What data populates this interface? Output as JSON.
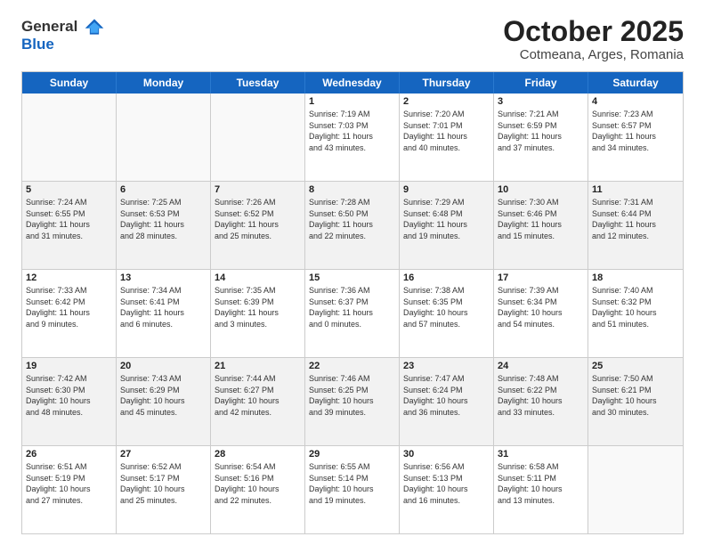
{
  "logo": {
    "general": "General",
    "blue": "Blue"
  },
  "title": "October 2025",
  "subtitle": "Cotmeana, Arges, Romania",
  "header_days": [
    "Sunday",
    "Monday",
    "Tuesday",
    "Wednesday",
    "Thursday",
    "Friday",
    "Saturday"
  ],
  "weeks": [
    [
      {
        "day": "",
        "info": ""
      },
      {
        "day": "",
        "info": ""
      },
      {
        "day": "",
        "info": ""
      },
      {
        "day": "1",
        "info": "Sunrise: 7:19 AM\nSunset: 7:03 PM\nDaylight: 11 hours\nand 43 minutes."
      },
      {
        "day": "2",
        "info": "Sunrise: 7:20 AM\nSunset: 7:01 PM\nDaylight: 11 hours\nand 40 minutes."
      },
      {
        "day": "3",
        "info": "Sunrise: 7:21 AM\nSunset: 6:59 PM\nDaylight: 11 hours\nand 37 minutes."
      },
      {
        "day": "4",
        "info": "Sunrise: 7:23 AM\nSunset: 6:57 PM\nDaylight: 11 hours\nand 34 minutes."
      }
    ],
    [
      {
        "day": "5",
        "info": "Sunrise: 7:24 AM\nSunset: 6:55 PM\nDaylight: 11 hours\nand 31 minutes."
      },
      {
        "day": "6",
        "info": "Sunrise: 7:25 AM\nSunset: 6:53 PM\nDaylight: 11 hours\nand 28 minutes."
      },
      {
        "day": "7",
        "info": "Sunrise: 7:26 AM\nSunset: 6:52 PM\nDaylight: 11 hours\nand 25 minutes."
      },
      {
        "day": "8",
        "info": "Sunrise: 7:28 AM\nSunset: 6:50 PM\nDaylight: 11 hours\nand 22 minutes."
      },
      {
        "day": "9",
        "info": "Sunrise: 7:29 AM\nSunset: 6:48 PM\nDaylight: 11 hours\nand 19 minutes."
      },
      {
        "day": "10",
        "info": "Sunrise: 7:30 AM\nSunset: 6:46 PM\nDaylight: 11 hours\nand 15 minutes."
      },
      {
        "day": "11",
        "info": "Sunrise: 7:31 AM\nSunset: 6:44 PM\nDaylight: 11 hours\nand 12 minutes."
      }
    ],
    [
      {
        "day": "12",
        "info": "Sunrise: 7:33 AM\nSunset: 6:42 PM\nDaylight: 11 hours\nand 9 minutes."
      },
      {
        "day": "13",
        "info": "Sunrise: 7:34 AM\nSunset: 6:41 PM\nDaylight: 11 hours\nand 6 minutes."
      },
      {
        "day": "14",
        "info": "Sunrise: 7:35 AM\nSunset: 6:39 PM\nDaylight: 11 hours\nand 3 minutes."
      },
      {
        "day": "15",
        "info": "Sunrise: 7:36 AM\nSunset: 6:37 PM\nDaylight: 11 hours\nand 0 minutes."
      },
      {
        "day": "16",
        "info": "Sunrise: 7:38 AM\nSunset: 6:35 PM\nDaylight: 10 hours\nand 57 minutes."
      },
      {
        "day": "17",
        "info": "Sunrise: 7:39 AM\nSunset: 6:34 PM\nDaylight: 10 hours\nand 54 minutes."
      },
      {
        "day": "18",
        "info": "Sunrise: 7:40 AM\nSunset: 6:32 PM\nDaylight: 10 hours\nand 51 minutes."
      }
    ],
    [
      {
        "day": "19",
        "info": "Sunrise: 7:42 AM\nSunset: 6:30 PM\nDaylight: 10 hours\nand 48 minutes."
      },
      {
        "day": "20",
        "info": "Sunrise: 7:43 AM\nSunset: 6:29 PM\nDaylight: 10 hours\nand 45 minutes."
      },
      {
        "day": "21",
        "info": "Sunrise: 7:44 AM\nSunset: 6:27 PM\nDaylight: 10 hours\nand 42 minutes."
      },
      {
        "day": "22",
        "info": "Sunrise: 7:46 AM\nSunset: 6:25 PM\nDaylight: 10 hours\nand 39 minutes."
      },
      {
        "day": "23",
        "info": "Sunrise: 7:47 AM\nSunset: 6:24 PM\nDaylight: 10 hours\nand 36 minutes."
      },
      {
        "day": "24",
        "info": "Sunrise: 7:48 AM\nSunset: 6:22 PM\nDaylight: 10 hours\nand 33 minutes."
      },
      {
        "day": "25",
        "info": "Sunrise: 7:50 AM\nSunset: 6:21 PM\nDaylight: 10 hours\nand 30 minutes."
      }
    ],
    [
      {
        "day": "26",
        "info": "Sunrise: 6:51 AM\nSunset: 5:19 PM\nDaylight: 10 hours\nand 27 minutes."
      },
      {
        "day": "27",
        "info": "Sunrise: 6:52 AM\nSunset: 5:17 PM\nDaylight: 10 hours\nand 25 minutes."
      },
      {
        "day": "28",
        "info": "Sunrise: 6:54 AM\nSunset: 5:16 PM\nDaylight: 10 hours\nand 22 minutes."
      },
      {
        "day": "29",
        "info": "Sunrise: 6:55 AM\nSunset: 5:14 PM\nDaylight: 10 hours\nand 19 minutes."
      },
      {
        "day": "30",
        "info": "Sunrise: 6:56 AM\nSunset: 5:13 PM\nDaylight: 10 hours\nand 16 minutes."
      },
      {
        "day": "31",
        "info": "Sunrise: 6:58 AM\nSunset: 5:11 PM\nDaylight: 10 hours\nand 13 minutes."
      },
      {
        "day": "",
        "info": ""
      }
    ]
  ]
}
